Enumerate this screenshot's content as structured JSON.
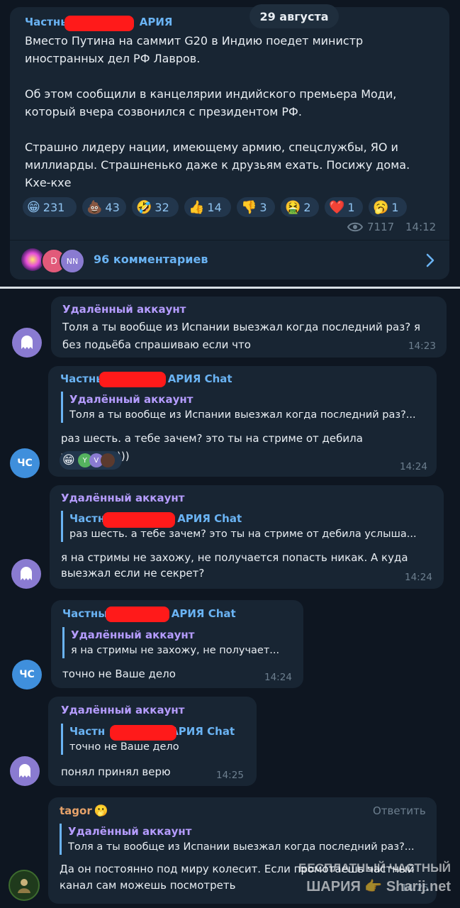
{
  "date_badge": "29 августа",
  "channel_post": {
    "author_left": "Частны",
    "author_right": "АРИЯ",
    "text": "Вместо Путина на саммит G20 в Индию поедет министр\nиностранных дел РФ Лавров.\n\nОб этом сообщили в канцелярии индийского премьера Моди,\nкоторый вчера созвонился с президентом РФ.\n\nСтрашно лидеру нации, имеющему армию, спецслужбы, ЯО и\nмиллиарды. Страшненько даже к друзьям ехать. Посижу дома.\nКхе-кхе",
    "reactions": [
      {
        "icon": "grin-emoji",
        "emoji": "😁",
        "count": "231"
      },
      {
        "icon": "poo-emoji",
        "emoji": "💩",
        "count": "43"
      },
      {
        "icon": "rofl-emoji",
        "emoji": "🤣",
        "count": "32"
      },
      {
        "icon": "thumbs-up-emoji",
        "emoji": "👍",
        "count": "14"
      },
      {
        "icon": "thumbs-down-emoji",
        "emoji": "👎",
        "count": "3"
      },
      {
        "icon": "nauseated-emoji",
        "emoji": "🤮",
        "count": "2"
      },
      {
        "icon": "heart-emoji",
        "emoji": "❤️",
        "count": "1"
      },
      {
        "icon": "yawn-emoji",
        "emoji": "🥱",
        "count": "1"
      }
    ],
    "views": "7117",
    "time": "14:12",
    "comments_avatars": [
      "D",
      "NN"
    ],
    "comments_label": "96 комментариев"
  },
  "messages": [
    {
      "author": "Удалённый аккаунт",
      "text": "Толя а ты вообще из Испании выезжал когда последний раз? я\nбез подьёба спрашиваю если что",
      "time": "14:23"
    },
    {
      "author_left": "Частнь",
      "author_right": "АРИЯ Chat",
      "avatar": "ЧС",
      "reply_name": "Удалённый аккаунт",
      "reply_text": "Толя а ты вообще из Испании выезжал когда последний раз?...",
      "text": "раз шесть. а тебе зачем? это ты на стриме от дебила услышал?)))",
      "reaction_emoji": "😁",
      "reaction_avatars": [
        "Y",
        "V"
      ],
      "time": "14:24"
    },
    {
      "author": "Удалённый аккаунт",
      "reply_left": "Частн",
      "reply_right": "АРИЯ Chat",
      "reply_text": "раз шесть. а тебе зачем? это ты на стриме от дебила услыша...",
      "text": "я на стримы не захожу, не получается попасть никак. А куда\nвыезжал если не секрет?",
      "time": "14:24"
    },
    {
      "author_left": "Частны",
      "author_right": "АРИЯ Chat",
      "avatar": "ЧС",
      "reply_name": "Удалённый аккаунт",
      "reply_text": "я на стримы не захожу, не получает...",
      "text": "точно не Ваше дело",
      "time": "14:24"
    },
    {
      "author": "Удалённый аккаунт",
      "reply_left": "Частн",
      "reply_right": "АРИЯ Chat",
      "reply_text": "точно не Ваше дело",
      "text": "понял принял верю",
      "time": "14:25"
    },
    {
      "author": "tagor",
      "reply_action": "Ответить",
      "reply_name": "Удалённый аккаунт",
      "reply_text": "Толя а ты вообще из Испании выезжал когда последний раз?...",
      "text": "Да он постоянно под миру колесит. Если промотаешь частный\nканал сам можешь посмотреть",
      "time": "14:25"
    }
  ],
  "watermark": {
    "line1": "БЕСПЛАТНЫЙ ЧАСТНЫЙ",
    "line2": "ШАРИЯ",
    "site": "Sharij.net"
  },
  "colors": {
    "background": "#0e1621",
    "bubble": "#182533",
    "accent": "#6ab3f3",
    "deleted_name": "#b59cff",
    "tagor_name": "#e6a26a",
    "redaction": "#ff1a1a"
  }
}
